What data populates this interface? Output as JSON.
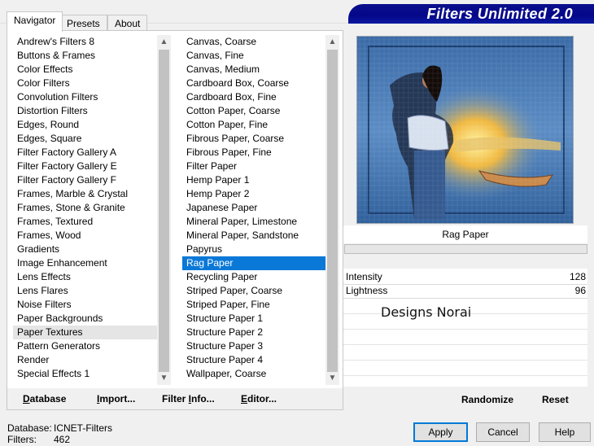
{
  "window": {
    "title_banner": "Filters Unlimited 2.0"
  },
  "tabs": [
    {
      "label": "Navigator",
      "active": true
    },
    {
      "label": "Presets",
      "active": false
    },
    {
      "label": "About",
      "active": false
    }
  ],
  "categories": {
    "items": [
      "Andrew's Filters 8",
      "Buttons & Frames",
      "Color Effects",
      "Color Filters",
      "Convolution Filters",
      "Distortion Filters",
      "Edges, Round",
      "Edges, Square",
      "Filter Factory Gallery A",
      "Filter Factory Gallery E",
      "Filter Factory Gallery F",
      "Frames, Marble & Crystal",
      "Frames, Stone & Granite",
      "Frames, Textured",
      "Frames, Wood",
      "Gradients",
      "Image Enhancement",
      "Lens Effects",
      "Lens Flares",
      "Noise Filters",
      "Paper Backgrounds",
      "Paper Textures",
      "Pattern Generators",
      "Render",
      "Special Effects 1"
    ],
    "selected": "Paper Textures"
  },
  "filters": {
    "items": [
      "Canvas, Coarse",
      "Canvas, Fine",
      "Canvas, Medium",
      "Cardboard Box, Coarse",
      "Cardboard Box, Fine",
      "Cotton Paper, Coarse",
      "Cotton Paper, Fine",
      "Fibrous Paper, Coarse",
      "Fibrous Paper, Fine",
      "Filter Paper",
      "Hemp Paper 1",
      "Hemp Paper 2",
      "Japanese Paper",
      "Mineral Paper, Limestone",
      "Mineral Paper, Sandstone",
      "Papyrus",
      "Rag Paper",
      "Recycling Paper",
      "Striped Paper, Coarse",
      "Striped Paper, Fine",
      "Structure Paper 1",
      "Structure Paper 2",
      "Structure Paper 3",
      "Structure Paper 4",
      "Wallpaper, Coarse"
    ],
    "selected": "Rag Paper"
  },
  "left_buttons": {
    "database": {
      "u": "D",
      "rest": "atabase"
    },
    "import": {
      "u": "I",
      "rest": "mport..."
    },
    "filter_info": {
      "pre": "Filter ",
      "u": "I",
      "rest": "nfo..."
    },
    "editor": {
      "u": "E",
      "rest": "ditor..."
    }
  },
  "preview": {
    "filter_name": "Rag Paper",
    "progress": 0
  },
  "parameters": [
    {
      "label": "Intensity",
      "value": "128"
    },
    {
      "label": "Lightness",
      "value": "96"
    }
  ],
  "watermark_text": "Designs Norai",
  "right_buttons": {
    "randomize": "Randomize",
    "reset": "Reset"
  },
  "footer": {
    "database_label": "Database:",
    "database_value": "ICNET-Filters",
    "filters_label": "Filters:",
    "filters_value": "462",
    "apply": "Apply",
    "cancel": "Cancel",
    "help": "Help"
  },
  "colors": {
    "banner": "#05078a",
    "selection": "#0a78d7",
    "default_button_border": "#0078d7"
  }
}
